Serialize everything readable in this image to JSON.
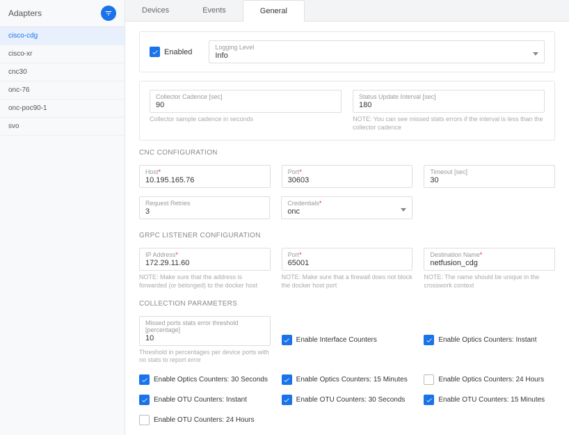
{
  "sidebar": {
    "title": "Adapters",
    "items": [
      {
        "label": "cisco-cdg",
        "selected": true
      },
      {
        "label": "cisco-xr",
        "selected": false
      },
      {
        "label": "cnc30",
        "selected": false
      },
      {
        "label": "onc-76",
        "selected": false
      },
      {
        "label": "onc-poc90-1",
        "selected": false
      },
      {
        "label": "svo",
        "selected": false
      }
    ]
  },
  "tabs": {
    "items": [
      "Devices",
      "Events",
      "General"
    ],
    "active": "General"
  },
  "general": {
    "enabled_label": "Enabled",
    "enabled": true,
    "logging_level": {
      "label": "Logging Level",
      "value": "Info"
    },
    "cadence": {
      "label": "Collector Cadence [sec]",
      "value": "90",
      "note": "Collector sample cadence in seconds"
    },
    "status_interval": {
      "label": "Status Update Interval [sec]",
      "value": "180",
      "note": "NOTE: You can see missed stats errors if the interval is less than the collector cadence"
    }
  },
  "cnc": {
    "title": "CNC CONFIGURATION",
    "host": {
      "label": "Host",
      "value": "10.195.165.76",
      "required": true
    },
    "port": {
      "label": "Port",
      "value": "30603",
      "required": true
    },
    "timeout": {
      "label": "Timeout [sec]",
      "value": "30"
    },
    "retries": {
      "label": "Request Retries",
      "value": "3"
    },
    "credentials": {
      "label": "Credentials",
      "value": "onc",
      "required": true
    }
  },
  "grpc": {
    "title": "GRPC LISTENER CONFIGURATION",
    "ip": {
      "label": "IP Address",
      "value": "172.29.11.60",
      "required": true,
      "note": "NOTE: Make sure that the address is forwarded (or belonged) to the docker host"
    },
    "port": {
      "label": "Port",
      "value": "65001",
      "required": true,
      "note": "NOTE: Make sure that a firewall does not block the docker host port"
    },
    "dest": {
      "label": "Destination Name",
      "value": "netfusion_cdg",
      "required": true,
      "note": "NOTE: The name should be unique in the crosswork context"
    }
  },
  "params": {
    "title": "COLLECTION PARAMETERS",
    "threshold": {
      "label": "Missed ports stats error threshold [percentage]",
      "value": "10",
      "note": "Threshold in percentages per device ports with no stats to report error"
    },
    "checks": [
      {
        "label": "Enable Interface Counters",
        "checked": true
      },
      {
        "label": "Enable Optics Counters: Instant",
        "checked": true
      },
      {
        "label": "Enable Optics Counters: 30 Seconds",
        "checked": true
      },
      {
        "label": "Enable Optics Counters: 15 Minutes",
        "checked": true
      },
      {
        "label": "Enable Optics Counters: 24 Hours",
        "checked": false
      },
      {
        "label": "Enable OTU Counters: Instant",
        "checked": true
      },
      {
        "label": "Enable OTU Counters: 30 Seconds",
        "checked": true
      },
      {
        "label": "Enable OTU Counters: 15 Minutes",
        "checked": true
      },
      {
        "label": "Enable OTU Counters: 24 Hours",
        "checked": false
      }
    ]
  }
}
